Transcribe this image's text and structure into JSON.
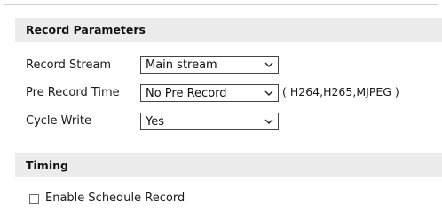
{
  "record_parameters": {
    "title": "Record Parameters",
    "rows": [
      {
        "label": "Record Stream",
        "value": "Main stream"
      },
      {
        "label": "Pre Record Time",
        "value": "No Pre Record",
        "note": "( H264,H265,MJPEG )"
      },
      {
        "label": "Cycle Write",
        "value": "Yes"
      }
    ]
  },
  "timing": {
    "title": "Timing",
    "enable_schedule": {
      "label": "Enable Schedule Record",
      "checked": false
    }
  },
  "icons": {
    "dropdown": "chevron-down-icon"
  }
}
